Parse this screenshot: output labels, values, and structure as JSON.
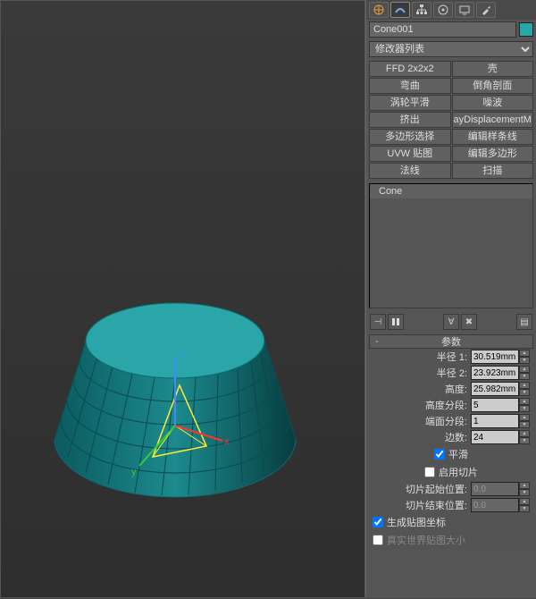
{
  "object_name": "Cone001",
  "object_color": "#27a7a7",
  "modifier_list_label": "修改器列表",
  "modifier_buttons": [
    [
      "FFD 2x2x2",
      "壳"
    ],
    [
      "弯曲",
      "倒角剖面"
    ],
    [
      "涡轮平滑",
      "噪波"
    ],
    [
      "挤出",
      "ayDisplacementM"
    ],
    [
      "多边形选择",
      "编辑样条线"
    ],
    [
      "UVW 贴图",
      "编辑多边形"
    ],
    [
      "法线",
      "扫描"
    ]
  ],
  "stack_item": "Cone",
  "rollup_params_title": "参数",
  "params": {
    "radius1_label": "半径 1:",
    "radius1": "30.519mm",
    "radius2_label": "半径 2:",
    "radius2": "23.923mm",
    "height_label": "高度:",
    "height": "25.982mm",
    "hseg_label": "高度分段:",
    "hseg": "5",
    "capseg_label": "端面分段:",
    "capseg": "1",
    "sides_label": "边数:",
    "sides": "24",
    "smooth_label": "平滑",
    "slice_on_label": "启用切片",
    "slice_from_label": "切片起始位置:",
    "slice_from": "0.0",
    "slice_to_label": "切片结束位置:",
    "slice_to": "0.0",
    "gen_map_label": "生成贴图坐标",
    "real_world_label": "真实世界贴图大小"
  },
  "chart_data": {
    "type": "table",
    "title": "Cone parameters",
    "rows": [
      {
        "name": "半径 1",
        "value": 30.519,
        "unit": "mm"
      },
      {
        "name": "半径 2",
        "value": 23.923,
        "unit": "mm"
      },
      {
        "name": "高度",
        "value": 25.982,
        "unit": "mm"
      },
      {
        "name": "高度分段",
        "value": 5
      },
      {
        "name": "端面分段",
        "value": 1
      },
      {
        "name": "边数",
        "value": 24
      }
    ]
  }
}
